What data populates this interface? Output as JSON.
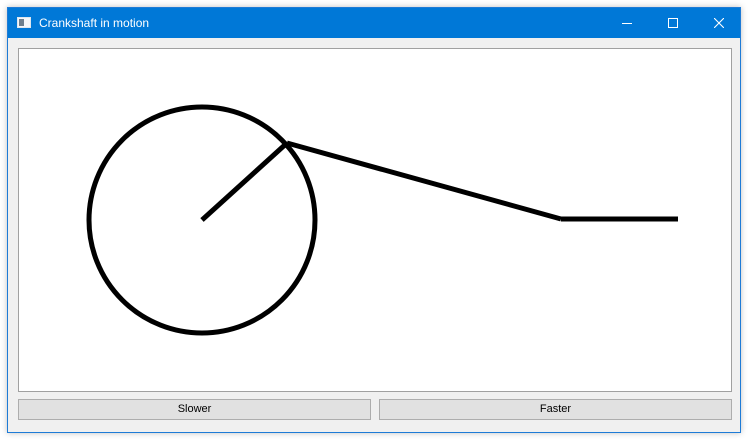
{
  "window": {
    "title": "Crankshaft in motion",
    "titlebar_color": "#0078d7",
    "controls": {
      "minimize_icon": "minimize-icon",
      "maximize_icon": "maximize-icon",
      "close_icon": "close-icon"
    }
  },
  "drawing": {
    "stroke_color": "#000000",
    "parts": [
      "crank-wheel",
      "crank-arm",
      "connecting-rod",
      "piston-rod"
    ]
  },
  "buttons": {
    "slower_label": "Slower",
    "faster_label": "Faster"
  }
}
